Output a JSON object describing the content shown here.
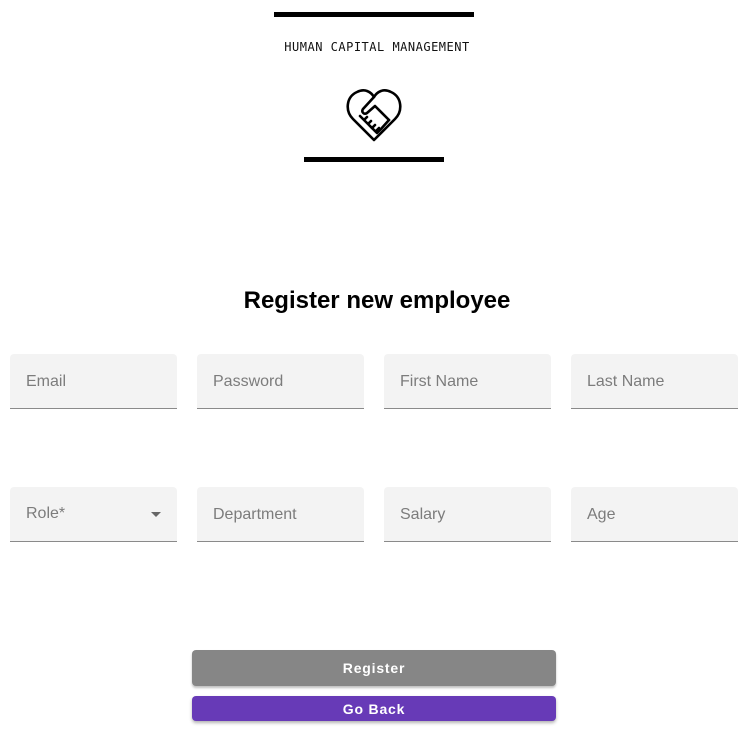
{
  "brand": {
    "title": "HUMAN CAPITAL MANAGEMENT",
    "logo_icon": "heart-handshake-icon"
  },
  "form": {
    "heading": "Register new employee",
    "fields": {
      "email": {
        "placeholder": "Email",
        "value": ""
      },
      "password": {
        "placeholder": "Password",
        "value": ""
      },
      "first_name": {
        "placeholder": "First Name",
        "value": ""
      },
      "last_name": {
        "placeholder": "Last Name",
        "value": ""
      },
      "role": {
        "label": "Role*",
        "value": ""
      },
      "department": {
        "placeholder": "Department",
        "value": ""
      },
      "salary": {
        "placeholder": "Salary",
        "value": ""
      },
      "age": {
        "placeholder": "Age",
        "value": ""
      }
    }
  },
  "actions": {
    "register_label": "Register",
    "back_label": "Go Back"
  },
  "colors": {
    "primary": "#673ab7",
    "disabled_button": "#868686",
    "field_background": "#f3f3f3"
  }
}
